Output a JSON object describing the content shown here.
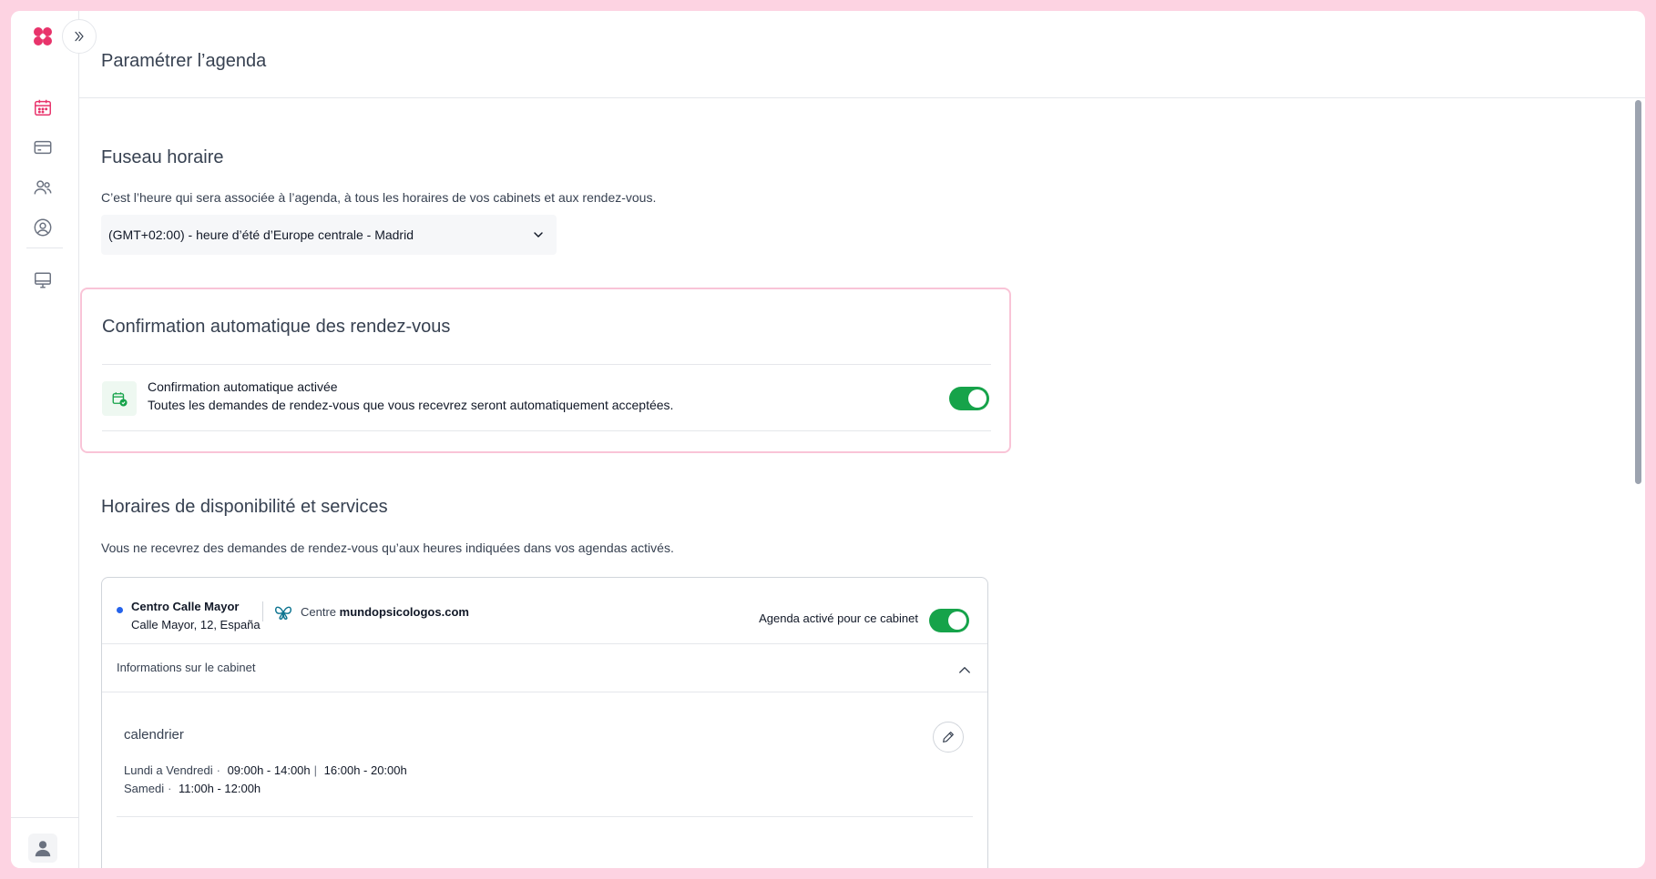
{
  "app": {
    "accent_color": "#e8336b",
    "toggle_color": "#16a34a"
  },
  "sidebar": {
    "logo_icon": "clover-logo-icon",
    "expand_icon": "double-chevron-right-icon",
    "items": [
      {
        "name": "calendar",
        "icon": "calendar-icon",
        "active": true
      },
      {
        "name": "payments",
        "icon": "card-icon",
        "active": false
      },
      {
        "name": "patients",
        "icon": "users-icon",
        "active": false
      },
      {
        "name": "profile",
        "icon": "user-circle-icon",
        "active": false
      },
      {
        "name": "display",
        "icon": "monitor-icon",
        "active": false
      }
    ]
  },
  "header": {
    "title": "Paramétrer l’agenda"
  },
  "timezone": {
    "title": "Fuseau horaire",
    "description": "C’est l’heure qui sera associée à l’agenda, à tous les horaires de vos cabinets et aux rendez-vous.",
    "selected": "(GMT+02:00) - heure d’été d’Europe centrale - Madrid"
  },
  "auto_confirm": {
    "title": "Confirmation automatique des rendez-vous",
    "label": "Confirmation automatique activée",
    "sublabel": "Toutes les demandes de rendez-vous que vous recevrez seront automatiquement acceptées.",
    "enabled": true
  },
  "availability": {
    "title": "Horaires de disponibilité et services",
    "description": "Vous ne recevrez des demandes de rendez-vous qu’aux heures indiquées dans vos agendas activés.",
    "centre": {
      "name": "Centro Calle Mayor",
      "address": "Calle Mayor, 12, España",
      "platform_prefix": "Centre",
      "platform_name": "mundopsicologos.com",
      "agenda_label": "Agenda activé pour ce cabinet",
      "agenda_enabled": true,
      "info_label": "Informations sur le cabinet",
      "calendar_title": "calendrier",
      "schedule": [
        {
          "days": "Lundi a Vendredi",
          "slot1": "09:00h - 14:00h",
          "slot2": "16:00h - 20:00h"
        },
        {
          "days": "Samedi",
          "slot1": "11:00h - 12:00h"
        }
      ]
    }
  }
}
